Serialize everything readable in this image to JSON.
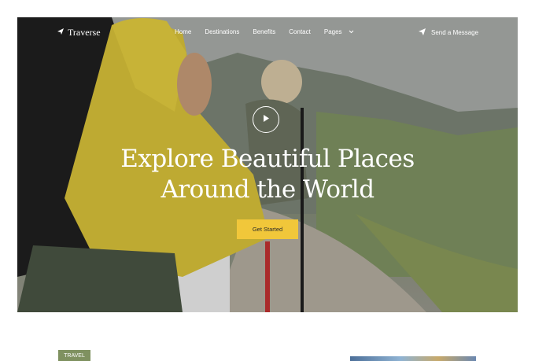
{
  "brand": {
    "name": "Traverse",
    "icon": "plane-icon"
  },
  "nav": {
    "links": [
      "Home",
      "Destinations",
      "Benefits",
      "Contact",
      "Pages"
    ],
    "pages_icon": "chevron-down-icon",
    "send_message": "Send a Message",
    "send_icon": "paper-plane-icon"
  },
  "hero": {
    "headline_line1": "Explore Beautiful Places",
    "headline_line2": "Around the World",
    "cta_label": "Get Started",
    "play_icon": "play-icon"
  },
  "section": {
    "tag": "TRAVEL"
  },
  "colors": {
    "accent": "#f1c73a",
    "tag": "#7f9160",
    "text": "#ffffff"
  }
}
